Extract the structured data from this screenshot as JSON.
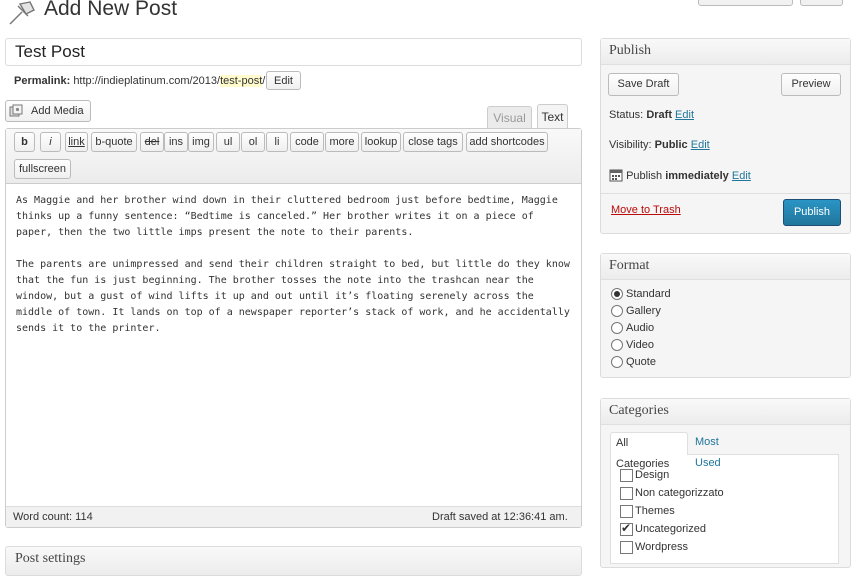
{
  "header": {
    "title": "Add New Post"
  },
  "post": {
    "title": "Test Post",
    "permalink_label": "Permalink:",
    "permalink_base": "http://indieplatinum.com/2013/",
    "permalink_slug": "test-post",
    "permalink_trail": "/",
    "permalink_edit": "Edit"
  },
  "media": {
    "add_label": "Add Media"
  },
  "editor": {
    "tab_visual": "Visual",
    "tab_text": "Text",
    "quicktags": [
      "b",
      "i",
      "link",
      "b-quote",
      "del",
      "ins",
      "img",
      "ul",
      "ol",
      "li",
      "code",
      "more",
      "lookup",
      "close tags",
      "add shortcodes",
      "fullscreen"
    ],
    "paragraphs": [
      "As Maggie and her brother wind down in their cluttered bedroom just before bedtime, Maggie thinks up a funny sentence: “Bedtime is canceled.” Her brother writes it on a piece of paper, then the two little imps present the note to their parents.",
      "The parents are unimpressed and send their children straight to bed, but little do they know that the fun is just beginning. The brother tosses the note into the trashcan near the window, but a gust of wind lifts it up and out until it’s floating serenely across the middle of town. It lands on top of a newspaper reporter’s stack of work, and he accidentally sends it to the printer."
    ],
    "word_count": "Word count: 114",
    "draft_saved": "Draft saved at 12:36:41 am."
  },
  "post_settings": {
    "title": "Post settings"
  },
  "publish": {
    "title": "Publish",
    "save_draft": "Save Draft",
    "preview": "Preview",
    "status_label": "Status:",
    "status_value": "Draft",
    "visibility_label": "Visibility:",
    "visibility_value": "Public",
    "schedule_label": "Publish",
    "schedule_value": "immediately",
    "edit": "Edit",
    "trash": "Move to Trash",
    "publish_button": "Publish"
  },
  "format": {
    "title": "Format",
    "options": [
      "Standard",
      "Gallery",
      "Audio",
      "Video",
      "Quote"
    ],
    "selected": "Standard"
  },
  "categories": {
    "title": "Categories",
    "tab_all": "All Categories",
    "tab_used": "Most Used",
    "items": [
      "Design",
      "Non categorizzato",
      "Themes",
      "Uncategorized",
      "Wordpress"
    ],
    "checked": "Uncategorized"
  },
  "colors": {
    "link": "#21759b",
    "primary_button": "#21759b",
    "trash": "#bc0b0b",
    "slug_highlight": "#fffbcc"
  }
}
